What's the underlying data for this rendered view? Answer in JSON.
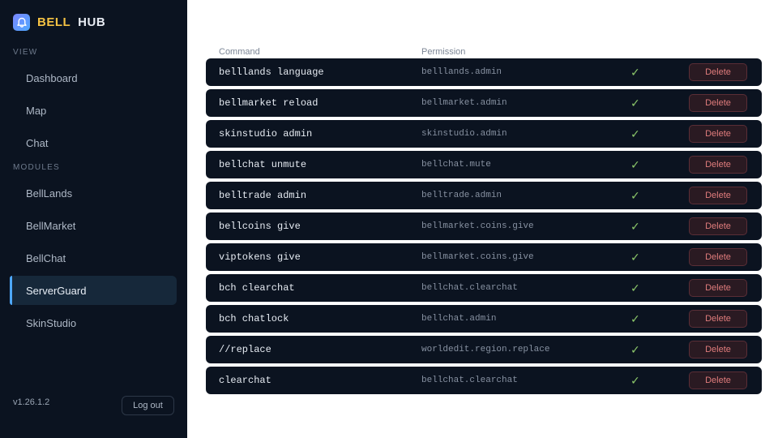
{
  "app": {
    "brand_part1": "BELL",
    "brand_part2": "HUB",
    "logo_icon": "bell-icon"
  },
  "sidebar": {
    "view_label": "VIEW",
    "view_items": [
      {
        "label": "Dashboard"
      },
      {
        "label": "Map"
      },
      {
        "label": "Chat"
      }
    ],
    "modules_label": "MODULES",
    "module_items": [
      {
        "label": "BellLands"
      },
      {
        "label": "BellMarket"
      },
      {
        "label": "BellChat"
      },
      {
        "label": "ServerGuard",
        "active": true
      },
      {
        "label": "SkinStudio"
      }
    ],
    "version": "v1.26.1.2",
    "logout_label": "Log out"
  },
  "table": {
    "headers": {
      "command": "Command",
      "permission": "Permission"
    },
    "rows": [
      {
        "command": "belllands language",
        "permission": "belllands.admin",
        "enabled": "✓",
        "action": "Delete"
      },
      {
        "command": "bellmarket reload",
        "permission": "bellmarket.admin",
        "enabled": "✓",
        "action": "Delete"
      },
      {
        "command": "skinstudio admin",
        "permission": "skinstudio.admin",
        "enabled": "✓",
        "action": "Delete"
      },
      {
        "command": "bellchat unmute",
        "permission": "bellchat.mute",
        "enabled": "✓",
        "action": "Delete"
      },
      {
        "command": "belltrade admin",
        "permission": "belltrade.admin",
        "enabled": "✓",
        "action": "Delete"
      },
      {
        "command": "bellcoins give",
        "permission": "bellmarket.coins.give",
        "enabled": "✓",
        "action": "Delete"
      },
      {
        "command": "viptokens give",
        "permission": "bellmarket.coins.give",
        "enabled": "✓",
        "action": "Delete"
      },
      {
        "command": "bch clearchat",
        "permission": "bellchat.clearchat",
        "enabled": "✓",
        "action": "Delete"
      },
      {
        "command": "bch chatlock",
        "permission": "bellchat.admin",
        "enabled": "✓",
        "action": "Delete"
      },
      {
        "command": "//replace",
        "permission": "worldedit.region.replace",
        "enabled": "✓",
        "action": "Delete"
      },
      {
        "command": "clearchat",
        "permission": "bellchat.clearchat",
        "enabled": "✓",
        "action": "Delete"
      }
    ]
  },
  "colors": {
    "sidebar_bg": "#0b1320",
    "accent": "#4ea8ff",
    "brand_yellow": "#f5c243",
    "check_green": "#8cc76a",
    "delete_red": "#e07c7c"
  }
}
